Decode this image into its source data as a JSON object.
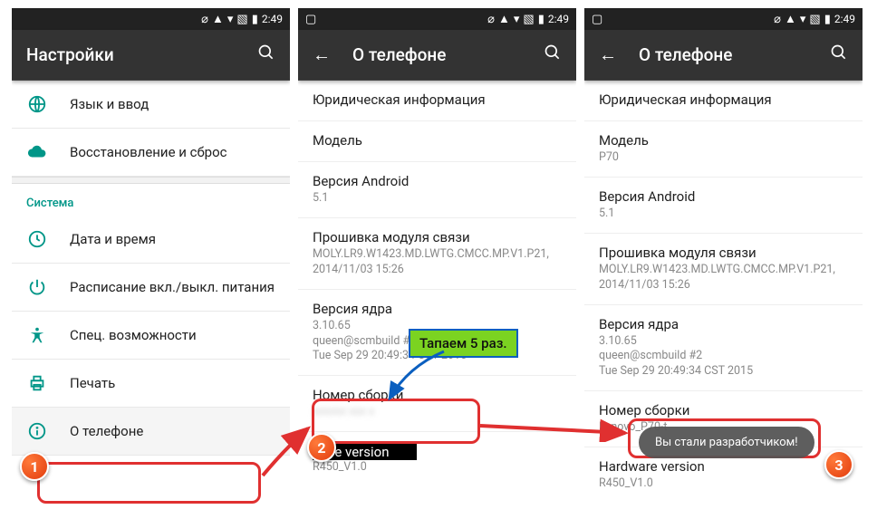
{
  "status": {
    "time": "2:49"
  },
  "screen1": {
    "title": "Настройки",
    "items": {
      "lang": "Язык и ввод",
      "backup": "Восстановление и сброс",
      "section": "Система",
      "datetime": "Дата и время",
      "schedule": "Расписание вкл./выкл. питания",
      "access": "Спец. возможности",
      "print": "Печать",
      "about": "О телефоне"
    }
  },
  "screen2": {
    "title": "О телефоне",
    "legal": "Юридическая информация",
    "model_label": "Модель",
    "model_value": "",
    "android_label": "Версия Android",
    "android_value": "5.1",
    "baseband_label": "Прошивка модуля связи",
    "baseband_value": "MOLY.LR9.W1423.MD.LWTG.CMCC.MP.V1.P21, 2014/11/03 15:26",
    "kernel_label": "Версия ядра",
    "kernel_value": "3.10.65\nqueen@scmbuild #2\nTue Sep 29 20:49:34 CST 2015",
    "build_label": "Номер сборки",
    "build_value": "",
    "hw_label": "Hardware version",
    "hw_value": "R450_V1.0"
  },
  "screen3": {
    "title": "О телефоне",
    "legal": "Юридическая информация",
    "model_label": "Модель",
    "model_value": "P70",
    "android_label": "Версия Android",
    "android_value": "5.1",
    "baseband_label": "Прошивка модуля связи",
    "baseband_value": "MOLY.LR9.W1423.MD.LWTG.CMCC.MP.V1.P21, 2014/11/03 15:26",
    "kernel_label": "Версия ядра",
    "kernel_value": "3.10.65\nqueen@scmbuild #2\nTue Sep 29 20:49:34 CST 2015",
    "build_label": "Номер сборки",
    "build_value": "Lenovo_P70-t",
    "hw_label": "Hardware version",
    "hw_value": "R450_V1.0"
  },
  "annotations": {
    "callout": "Тапаем 5 раз.",
    "toast": "Вы стали разработчиком!",
    "badge1": "1",
    "badge2": "2",
    "badge3": "3"
  }
}
